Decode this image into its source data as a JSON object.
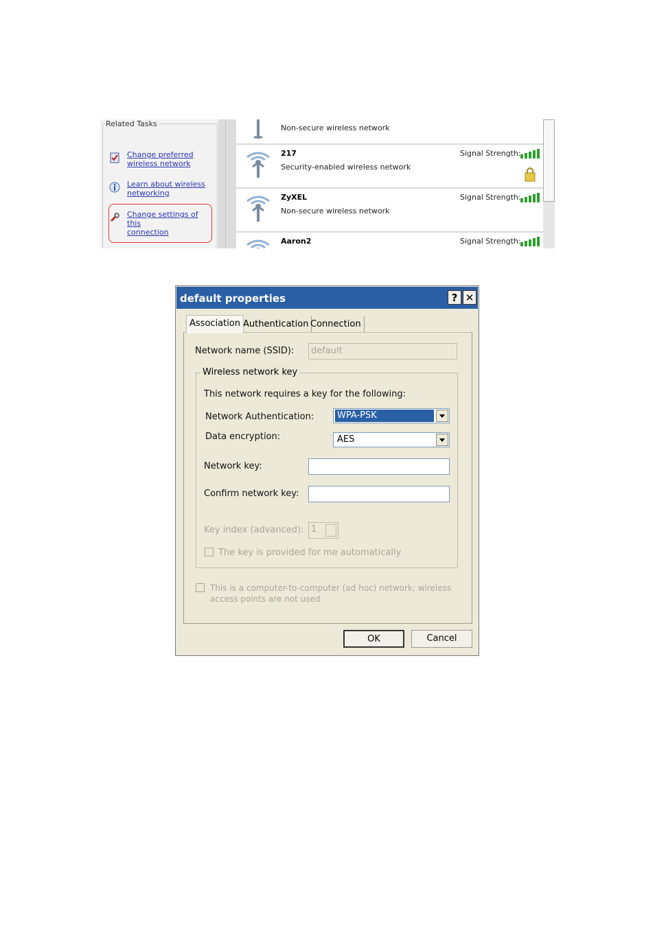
{
  "network_window": {
    "related_tasks": {
      "title": "Related Tasks",
      "items": [
        {
          "label_line1": "Change preferred",
          "label_line2": "wireless network",
          "icon": "preferred-networks-icon"
        },
        {
          "label_line1": "Learn about wireless",
          "label_line2": "networking",
          "icon": "info-icon"
        },
        {
          "label_line1": "Change settings of this",
          "label_line2": "connection",
          "icon": "wrench-icon"
        }
      ]
    },
    "networks": [
      {
        "name": "",
        "status": "Non-secure wireless network",
        "signal_label": ""
      },
      {
        "name": "217",
        "status": "Security-enabled wireless network",
        "signal_label": "Signal Strength:",
        "secured": true
      },
      {
        "name": "ZyXEL",
        "status": "Non-secure wireless network",
        "signal_label": "Signal Strength:"
      },
      {
        "name": "Aaron2",
        "status": "",
        "signal_label": "Signal Strength:"
      }
    ],
    "signal_bars": 5,
    "colors": {
      "link": "#2a36b0",
      "signal": "#2e9e2e",
      "highlight": "#e03a3a"
    }
  },
  "dialog": {
    "title": "default properties",
    "help_label": "?",
    "close_label": "✕",
    "tabs": [
      "Association",
      "Authentication",
      "Connection"
    ],
    "active_tab": "Association",
    "ssid_label": "Network name (SSID):",
    "ssid_value": "default",
    "group_title": "Wireless network key",
    "requires_text": "This network requires a key for the following:",
    "auth_label": "Network Authentication:",
    "auth_value": "WPA-PSK",
    "enc_label": "Data encryption:",
    "enc_value": "AES",
    "key_label": "Network key:",
    "key_value": "",
    "confirm_label": "Confirm network key:",
    "confirm_value": "",
    "key_index_label": "Key index (advanced):",
    "key_index_value": "1",
    "auto_key_label": "The key is provided for me automatically",
    "adhoc_line1": "This is a computer-to-computer (ad hoc) network; wireless",
    "adhoc_line2": "access points are not used",
    "ok_label": "OK",
    "cancel_label": "Cancel",
    "colors": {
      "titlebar": "#2a5fa6",
      "face": "#ece9d8"
    }
  }
}
